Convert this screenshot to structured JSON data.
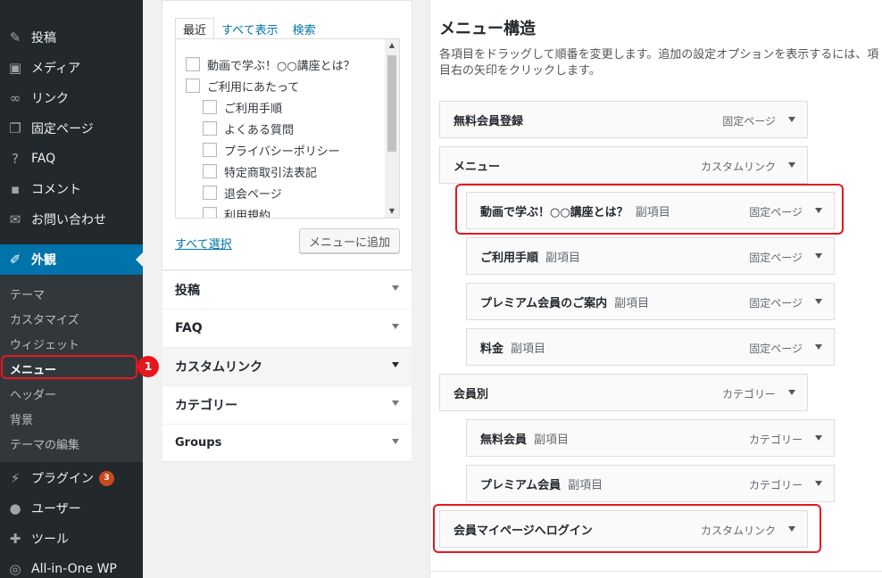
{
  "sidebar": {
    "items": [
      {
        "label": "投稿",
        "icon": "pin-icon",
        "glyph": "📌"
      },
      {
        "label": "メディア",
        "icon": "media-icon",
        "glyph": "🎞"
      },
      {
        "label": "リンク",
        "icon": "link-icon",
        "glyph": "🔗"
      },
      {
        "label": "固定ページ",
        "icon": "page-icon",
        "glyph": "❐"
      },
      {
        "label": "FAQ",
        "icon": "help-icon",
        "glyph": "❓"
      },
      {
        "label": "コメント",
        "icon": "comment-icon",
        "glyph": "💬"
      },
      {
        "label": "お問い合わせ",
        "icon": "mail-icon",
        "glyph": "✉"
      },
      {
        "label": "外観",
        "icon": "appearance-icon",
        "glyph": "🖌"
      },
      {
        "label": "プラグイン",
        "icon": "plugin-icon",
        "glyph": "🔌",
        "badge": "3"
      },
      {
        "label": "ユーザー",
        "icon": "user-icon",
        "glyph": "👤"
      },
      {
        "label": "ツール",
        "icon": "tools-icon",
        "glyph": "🔧"
      },
      {
        "label": "All-in-One WP",
        "icon": "all-in-one-wp-icon",
        "glyph": "◎"
      }
    ],
    "submenu": [
      "テーマ",
      "カスタマイズ",
      "ウィジェット",
      "メニュー",
      "ヘッダー",
      "背景",
      "テーマの編集"
    ],
    "annotation_number": "1"
  },
  "add_items": {
    "tabs": [
      "最近",
      "すべて表示",
      "検索"
    ],
    "pages": [
      {
        "label": "動画で学ぶ！○○講座とは？",
        "indent": 0
      },
      {
        "label": "ご利用にあたって",
        "indent": 0
      },
      {
        "label": "ご利用手順",
        "indent": 1
      },
      {
        "label": "よくある質問",
        "indent": 1
      },
      {
        "label": "プライバシーポリシー",
        "indent": 1
      },
      {
        "label": "特定商取引法表記",
        "indent": 1
      },
      {
        "label": "退会ページ",
        "indent": 1
      },
      {
        "label": "利用規約",
        "indent": 1
      }
    ],
    "select_all": "すべて選択",
    "add_button": "メニューに追加",
    "sections": [
      "投稿",
      "FAQ",
      "カスタムリンク",
      "カテゴリー",
      "Groups"
    ]
  },
  "menu_structure": {
    "title": "メニュー構造",
    "description": "各項目をドラッグして順番を変更します。追加の設定オプションを表示するには、項目右の矢印をクリックします。",
    "items": [
      {
        "label": "無料会員登録",
        "sub": "",
        "type": "固定ページ"
      },
      {
        "label": "メニュー",
        "sub": "",
        "type": "カスタムリンク"
      },
      {
        "label": "動画で学ぶ！○○講座とは？",
        "sub": "副項目",
        "type": "固定ページ"
      },
      {
        "label": "ご利用手順",
        "sub": "副項目",
        "type": "固定ページ"
      },
      {
        "label": "プレミアム会員のご案内",
        "sub": "副項目",
        "type": "固定ページ"
      },
      {
        "label": "料金",
        "sub": "副項目",
        "type": "固定ページ"
      },
      {
        "label": "会員別",
        "sub": "",
        "type": "カテゴリー"
      },
      {
        "label": "無料会員",
        "sub": "副項目",
        "type": "カテゴリー"
      },
      {
        "label": "プレミアム会員",
        "sub": "副項目",
        "type": "カテゴリー"
      },
      {
        "label": "会員マイページへログイン",
        "sub": "",
        "type": "カスタムリンク"
      }
    ]
  }
}
